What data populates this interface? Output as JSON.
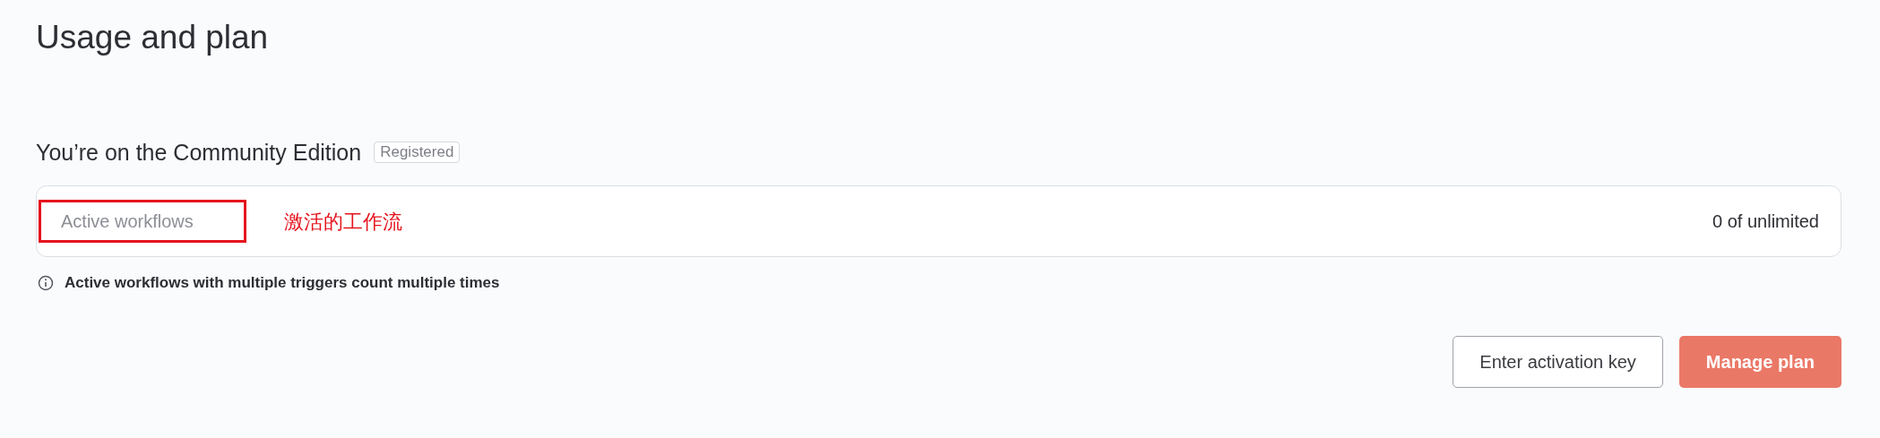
{
  "title": "Usage and plan",
  "plan": {
    "heading": "You’re on the Community Edition",
    "badge": "Registered"
  },
  "usage_rows": [
    {
      "label": "Active workflows",
      "highlighted": true,
      "annotation": "激活的工作流",
      "value": "0 of unlimited"
    }
  ],
  "info_note": "Active workflows with multiple triggers count multiple times",
  "buttons": [
    {
      "label": "Enter activation key",
      "kind": "secondary"
    },
    {
      "label": "Manage plan",
      "kind": "primary"
    }
  ]
}
